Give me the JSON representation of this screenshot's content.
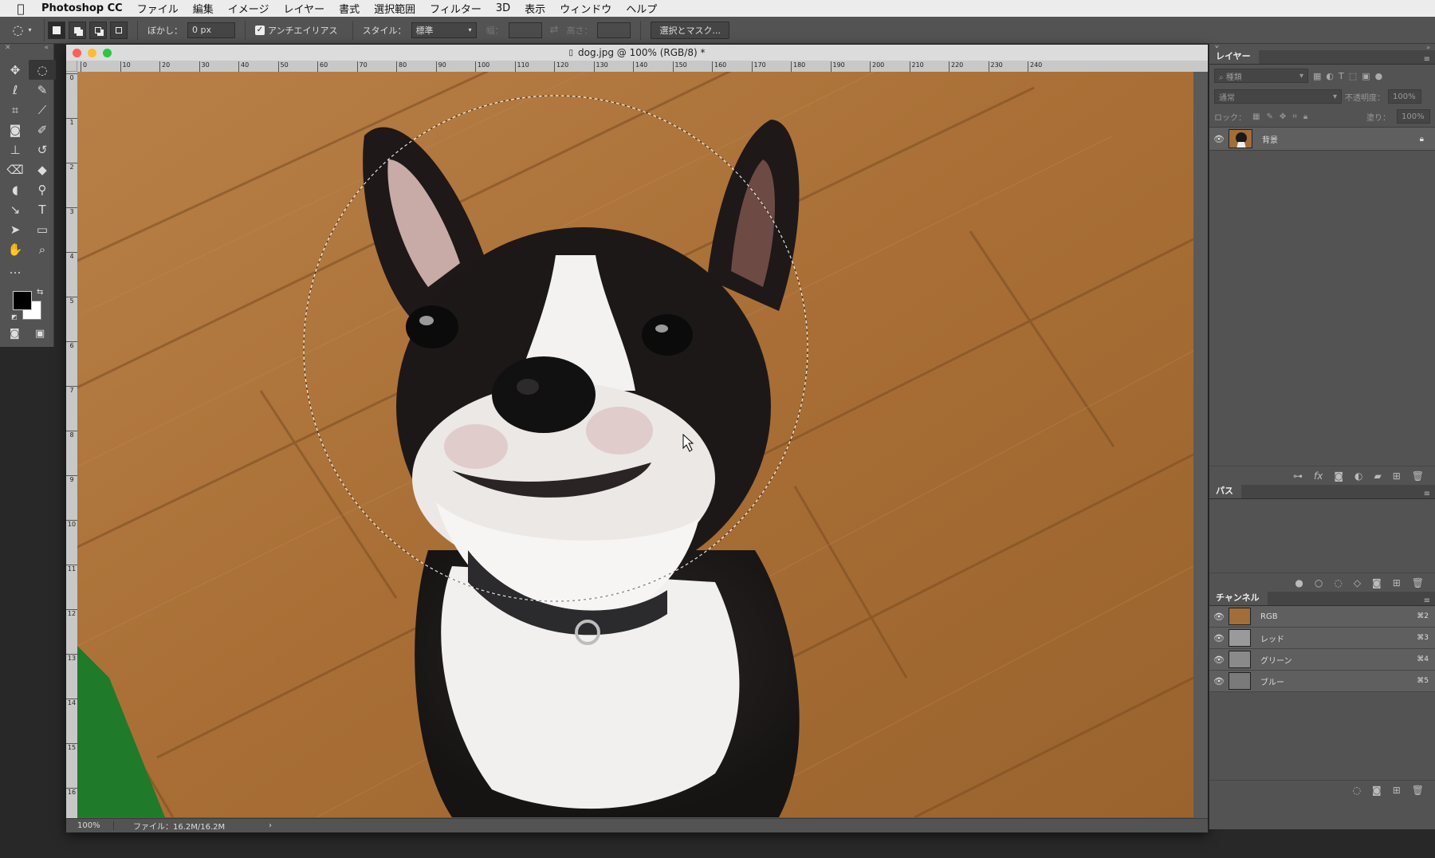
{
  "menubar": {
    "apple_icon": "apple-logo",
    "app_name": "Photoshop CC",
    "items": [
      "ファイル",
      "編集",
      "イメージ",
      "レイヤー",
      "書式",
      "選択範囲",
      "フィルター",
      "3D",
      "表示",
      "ウィンドウ",
      "ヘルプ"
    ]
  },
  "options": {
    "feather_label": "ぼかし：",
    "feather_value": "0 px",
    "antialias_label": "アンチエイリアス",
    "antialias_checked": true,
    "style_label": "スタイル：",
    "style_value": "標準",
    "width_label": "幅：",
    "height_label": "高さ：",
    "select_mask_label": "選択とマスク..."
  },
  "toolbox": {
    "tools": [
      {
        "name": "move-tool-icon",
        "glyph": "✥",
        "active": false
      },
      {
        "name": "elliptical-marquee-tool-icon",
        "glyph": "◌",
        "active": true
      },
      {
        "name": "lasso-tool-icon",
        "glyph": "ℓ",
        "active": false
      },
      {
        "name": "quick-selection-tool-icon",
        "glyph": "✎",
        "active": false
      },
      {
        "name": "crop-tool-icon",
        "glyph": "⌗",
        "active": false
      },
      {
        "name": "eyedropper-tool-icon",
        "glyph": "⟋",
        "active": false
      },
      {
        "name": "spot-healing-tool-icon",
        "glyph": "◙",
        "active": false
      },
      {
        "name": "brush-tool-icon",
        "glyph": "✐",
        "active": false
      },
      {
        "name": "clone-stamp-tool-icon",
        "glyph": "⊥",
        "active": false
      },
      {
        "name": "history-brush-tool-icon",
        "glyph": "↺",
        "active": false
      },
      {
        "name": "eraser-tool-icon",
        "glyph": "⌫",
        "active": false
      },
      {
        "name": "paint-bucket-tool-icon",
        "glyph": "◆",
        "active": false
      },
      {
        "name": "blur-tool-icon",
        "glyph": "◖",
        "active": false
      },
      {
        "name": "dodge-tool-icon",
        "glyph": "⚲",
        "active": false
      },
      {
        "name": "pen-tool-icon",
        "glyph": "↘",
        "active": false
      },
      {
        "name": "type-tool-icon",
        "glyph": "T",
        "active": false
      },
      {
        "name": "path-selection-tool-icon",
        "glyph": "➤",
        "active": false
      },
      {
        "name": "rectangle-tool-icon",
        "glyph": "▭",
        "active": false
      },
      {
        "name": "hand-tool-icon",
        "glyph": "✋",
        "active": false
      },
      {
        "name": "zoom-tool-icon",
        "glyph": "⌕",
        "active": false
      },
      {
        "name": "more-tools-icon",
        "glyph": "…",
        "active": false
      },
      {
        "name": "blank-slot",
        "glyph": "",
        "active": false
      }
    ],
    "foreground_color": "#000000",
    "background_color": "#ffffff"
  },
  "document": {
    "title": "dog.jpg @ 100% (RGB/8) *",
    "zoom": "100%",
    "file_info": "ファイル：16.2M/16.2M",
    "ruler_h_ticks": [
      "0",
      "10",
      "20",
      "30",
      "40",
      "50",
      "60",
      "70",
      "80",
      "90",
      "100",
      "110",
      "120",
      "130",
      "140",
      "150",
      "160",
      "170",
      "180",
      "190",
      "200",
      "210",
      "220",
      "230",
      "240"
    ],
    "ruler_v_ticks": [
      "0",
      "1",
      "2",
      "3",
      "4",
      "5",
      "6",
      "7",
      "8",
      "9",
      "10",
      "11",
      "12",
      "13",
      "14",
      "15",
      "16"
    ]
  },
  "layers_panel": {
    "tab": "レイヤー",
    "search_placeholder": "種類",
    "blend_mode": "通常",
    "opacity_label": "不透明度：",
    "opacity_value": "100%",
    "lock_label": "ロック：",
    "fill_label": "塗り：",
    "fill_value": "100%",
    "layers": [
      {
        "name": "背景",
        "visible": true,
        "locked": true
      }
    ]
  },
  "paths_panel": {
    "tab": "パス"
  },
  "channels_panel": {
    "tab": "チャンネル",
    "channels": [
      {
        "name": "RGB",
        "shortcut": "⌘2"
      },
      {
        "name": "レッド",
        "shortcut": "⌘3"
      },
      {
        "name": "グリーン",
        "shortcut": "⌘4"
      },
      {
        "name": "ブルー",
        "shortcut": "⌘5"
      }
    ]
  },
  "colors": {
    "ui_dark": "#535353",
    "ui_darker": "#454545",
    "accent_green_window": "#28c840",
    "close_red": "#ff5f57",
    "minimize_yellow": "#febc2e"
  }
}
